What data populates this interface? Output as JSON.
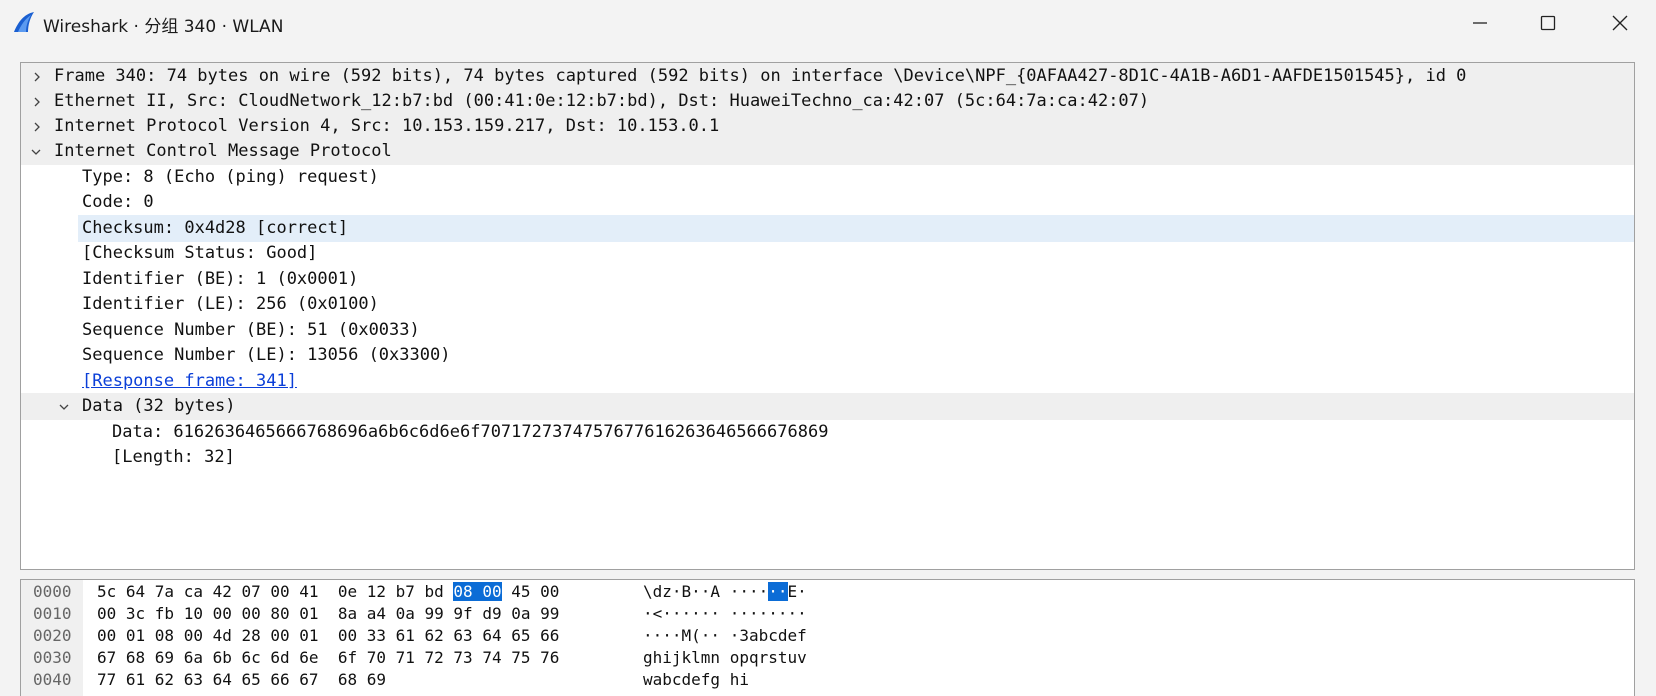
{
  "window": {
    "title": "Wireshark · 分组 340 · WLAN",
    "icon": "wireshark-fin-icon",
    "accent": "#1a5fd1"
  },
  "tree": [
    {
      "text": "Frame 340: 74 bytes on wire (592 bits), 74 bytes captured (592 bits) on interface \\Device\\NPF_{0AFAA427-8D1C-4A1B-A6D1-AAFDE1501545}, id 0",
      "state": "collapsed"
    },
    {
      "text": "Ethernet II, Src: CloudNetwork_12:b7:bd (00:41:0e:12:b7:bd), Dst: HuaweiTechno_ca:42:07 (5c:64:7a:ca:42:07)",
      "state": "collapsed"
    },
    {
      "text": "Internet Protocol Version 4, Src: 10.153.159.217, Dst: 10.153.0.1",
      "state": "collapsed"
    },
    {
      "text": "Internet Control Message Protocol",
      "state": "expanded"
    },
    {
      "text": "Type: 8 (Echo (ping) request)"
    },
    {
      "text": "Code: 0"
    },
    {
      "text": "Checksum: 0x4d28 [correct]",
      "selected": true
    },
    {
      "text": "[Checksum Status: Good]"
    },
    {
      "text": "Identifier (BE): 1 (0x0001)"
    },
    {
      "text": "Identifier (LE): 256 (0x0100)"
    },
    {
      "text": "Sequence Number (BE): 51 (0x0033)"
    },
    {
      "text": "Sequence Number (LE): 13056 (0x3300)"
    },
    {
      "text": "[Response frame: 341]",
      "link": true
    },
    {
      "text": "Data (32 bytes)",
      "state": "expanded"
    },
    {
      "text": "Data: 6162636465666768696a6b6c6d6e6f7071727374757677616263646566676869"
    },
    {
      "text": "[Length: 32]"
    }
  ],
  "hex": [
    {
      "offset": "0000",
      "bytes_pre": "5c 64 7a ca 42 07 00 41  0e 12 b7 bd ",
      "bytes_hl": "08 00",
      "bytes_post": " 45 00",
      "ascii_pre": "\\dz·B··A ····",
      "ascii_hl": "··",
      "ascii_post": "E·"
    },
    {
      "offset": "0010",
      "bytes_pre": "00 3c fb 10 00 00 80 01  8a a4 0a 99 9f d9 0a 99",
      "bytes_hl": "",
      "bytes_post": "",
      "ascii_pre": "·<······ ········",
      "ascii_hl": "",
      "ascii_post": ""
    },
    {
      "offset": "0020",
      "bytes_pre": "00 01 08 00 4d 28 00 01  00 33 61 62 63 64 65 66",
      "bytes_hl": "",
      "bytes_post": "",
      "ascii_pre": "····M(·· ·3abcdef",
      "ascii_hl": "",
      "ascii_post": ""
    },
    {
      "offset": "0030",
      "bytes_pre": "67 68 69 6a 6b 6c 6d 6e  6f 70 71 72 73 74 75 76",
      "bytes_hl": "",
      "bytes_post": "",
      "ascii_pre": "ghijklmn opqrstuv",
      "ascii_hl": "",
      "ascii_post": ""
    },
    {
      "offset": "0040",
      "bytes_pre": "77 61 62 63 64 65 66 67  68 69",
      "bytes_hl": "",
      "bytes_post": "",
      "ascii_pre": "wabcdefg hi",
      "ascii_hl": "",
      "ascii_post": ""
    }
  ],
  "colors": {
    "selected_row": "#e3eef9",
    "group_row": "#efefef",
    "byte_highlight": "#0b6cd6",
    "link": "#0b3fd8"
  }
}
